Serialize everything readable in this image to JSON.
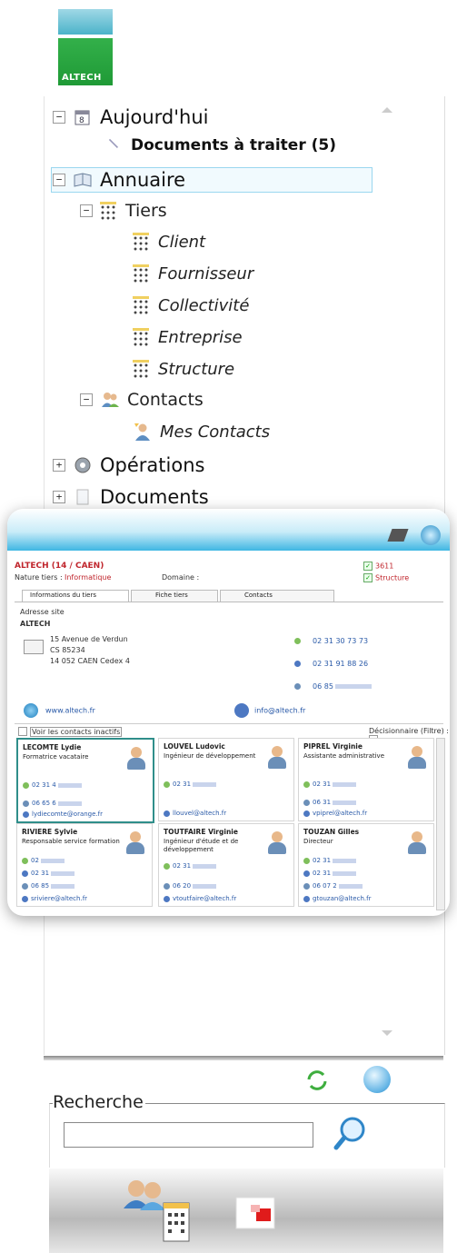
{
  "brand": {
    "logo_text": "ALTECH"
  },
  "tree": {
    "items": [
      {
        "label": "Aujourd'hui",
        "expander": "−"
      },
      {
        "label": "Documents à traiter (5)"
      },
      {
        "label": "Annuaire",
        "expander": "−"
      },
      {
        "label": "Tiers",
        "expander": "−"
      },
      {
        "label": "Client"
      },
      {
        "label": "Fournisseur"
      },
      {
        "label": "Collectivité"
      },
      {
        "label": "Entreprise"
      },
      {
        "label": "Structure"
      },
      {
        "label": "Contacts",
        "expander": "−"
      },
      {
        "label": "Mes Contacts"
      },
      {
        "label": "Opérations",
        "expander": "+"
      },
      {
        "label": "Documents",
        "expander": "+"
      }
    ]
  },
  "card": {
    "title": "ALTECH  (14 / CAEN)",
    "nature_label": "Nature tiers :",
    "nature_value": "Informatique",
    "domaine_label": "Domaine :",
    "code": "3611",
    "structure_label": "Structure",
    "tabs": [
      "Informations du tiers",
      "Fiche tiers",
      "Contacts"
    ],
    "adresse_site_label": "Adresse site",
    "company": "ALTECH",
    "address": [
      "15 Avenue de Verdun",
      "CS 85234",
      "14 052  CAEN    Cedex 4"
    ],
    "phone1": "02 31 30 73 73",
    "fax": "02 31 91 88 26",
    "mobile": "06 85",
    "website": "www.altech.fr",
    "email": "info@altech.fr",
    "show_inactive_label": "Voir les contacts inactifs",
    "decision_label": "Décisionnaire (Filtre) :",
    "contacts": [
      {
        "name": "LECOMTE Lydie",
        "role": "Formatrice vacataire",
        "tel": "02 31 4",
        "mobile": "06 65 6",
        "email": "lydiecomte@orange.fr"
      },
      {
        "name": "LOUVEL Ludovic",
        "role": "Ingénieur de développement",
        "tel": "02 31",
        "mobile": "",
        "email": "llouvel@altech.fr"
      },
      {
        "name": "PIPREL Virginie",
        "role": "Assistante administrative",
        "tel": "02 31",
        "mobile": "06 31",
        "email": "vpiprel@altech.fr"
      },
      {
        "name": "RIVIERE Sylvie",
        "role": "Responsable service formation",
        "tel": "02",
        "fax": "02 31",
        "mobile": "06 85",
        "email": "sriviere@altech.fr"
      },
      {
        "name": "TOUTFAIRE Virginie",
        "role": "Ingénieur d'étude et de développement",
        "tel": "02 31",
        "mobile": "06 20",
        "email": "vtoutfaire@altech.fr"
      },
      {
        "name": "TOUZAN Gilles",
        "role": "Directeur",
        "tel": "02 31",
        "fax": "02 31",
        "mobile": "06 07 2",
        "email": "gtouzan@altech.fr"
      }
    ]
  },
  "search": {
    "label": "Recherche",
    "value": ""
  }
}
